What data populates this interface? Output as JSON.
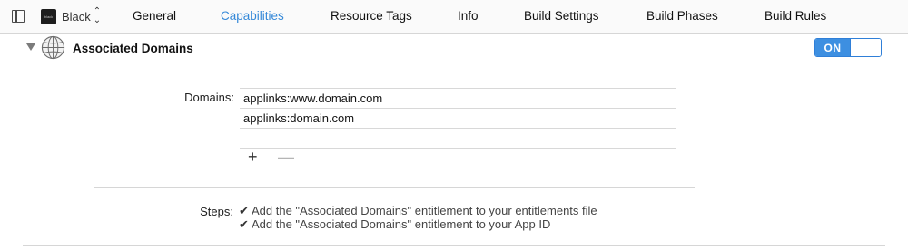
{
  "tabbar": {
    "target_name": "Black",
    "target_icon_text": "black",
    "tabs": [
      "General",
      "Capabilities",
      "Resource Tags",
      "Info",
      "Build Settings",
      "Build Phases",
      "Build Rules"
    ],
    "active_tab": "Capabilities"
  },
  "capability": {
    "title": "Associated Domains",
    "toggle_label": "ON",
    "domains_label": "Domains:",
    "domains": [
      "applinks:www.domain.com",
      "applinks:domain.com"
    ],
    "add_label": "+",
    "remove_label": "—",
    "steps_label": "Steps:",
    "check_glyph": "✔",
    "steps": [
      "Add the \"Associated Domains\" entitlement to your entitlements file",
      "Add the \"Associated Domains\" entitlement to your App ID"
    ]
  },
  "colors": {
    "accent": "#3d8fe1",
    "active_tab": "#3488d8"
  }
}
